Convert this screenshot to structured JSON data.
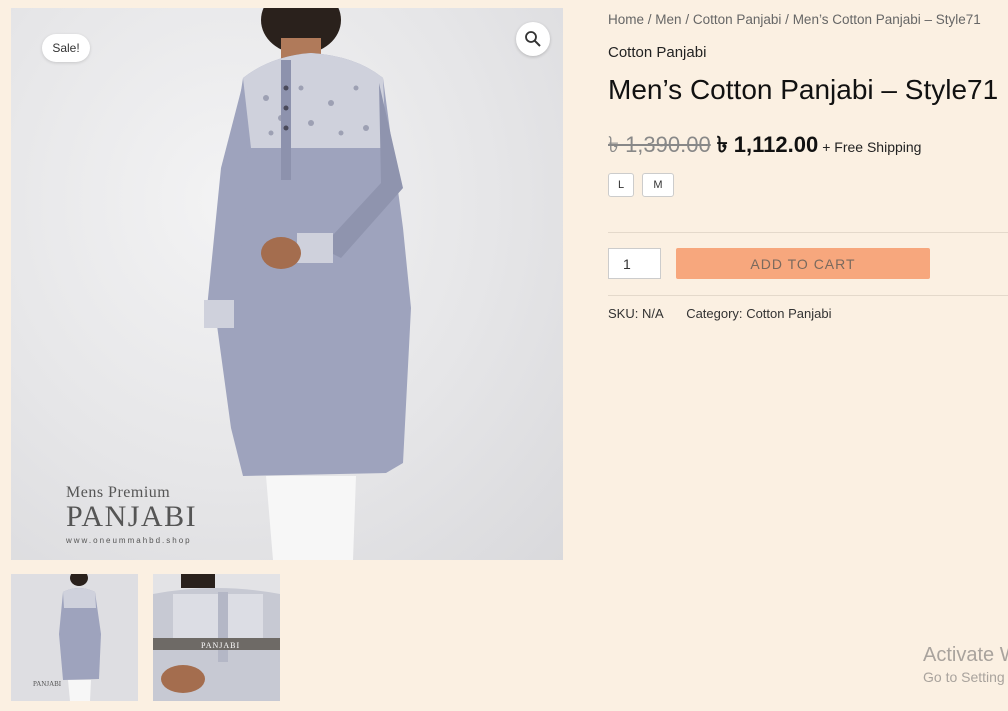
{
  "gallery": {
    "sale_badge": "Sale!",
    "zoom_icon": "magnifier-icon",
    "watermark_line1": "Mens Premium",
    "watermark_line2": "PANJABI",
    "watermark_line3": "www.oneummahbd.shop",
    "thumb2_watermark": "PANJABI"
  },
  "breadcrumb": {
    "items": [
      "Home",
      "Men",
      "Cotton Panjabi",
      "Men’s Cotton Panjabi – Style71"
    ],
    "separator": "/"
  },
  "product": {
    "category_label": "Cotton Panjabi",
    "title": "Men’s Cotton Panjabi – Style71",
    "price_old": "৳ 1,390.00",
    "price_new": "৳ 1,112.00",
    "shipping": "+ Free Shipping",
    "sizes": [
      "L",
      "M"
    ],
    "quantity": "1",
    "add_to_cart_label": "ADD TO CART",
    "sku_label": "SKU:",
    "sku_value": "N/A",
    "category_meta_label": "Category:",
    "category_meta_value": "Cotton Panjabi"
  },
  "os_overlay": {
    "line1": "Activate W",
    "line2": "Go to Setting"
  },
  "colors": {
    "page_bg": "#fbf0e2",
    "button": "#f7a77d",
    "garment": "#9ea3bd"
  }
}
